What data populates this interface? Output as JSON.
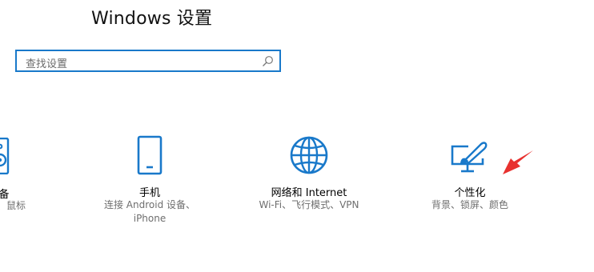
{
  "header": {
    "title": "Windows 设置"
  },
  "search": {
    "placeholder": "查找设置"
  },
  "tiles": [
    {
      "name": "备",
      "desc": "机、鼠标",
      "icon": "device-icon"
    },
    {
      "name": "手机",
      "desc_line1": "连接 Android 设备、",
      "desc_line2": "iPhone",
      "icon": "phone-icon"
    },
    {
      "name": "网络和 Internet",
      "desc": "Wi-Fi、飞行模式、VPN",
      "icon": "globe-icon"
    },
    {
      "name": "个性化",
      "desc": "背景、锁屏、颜色",
      "icon": "personalization-icon"
    }
  ],
  "colors": {
    "accent": "#1979ca",
    "arrow": "#e8312f"
  }
}
